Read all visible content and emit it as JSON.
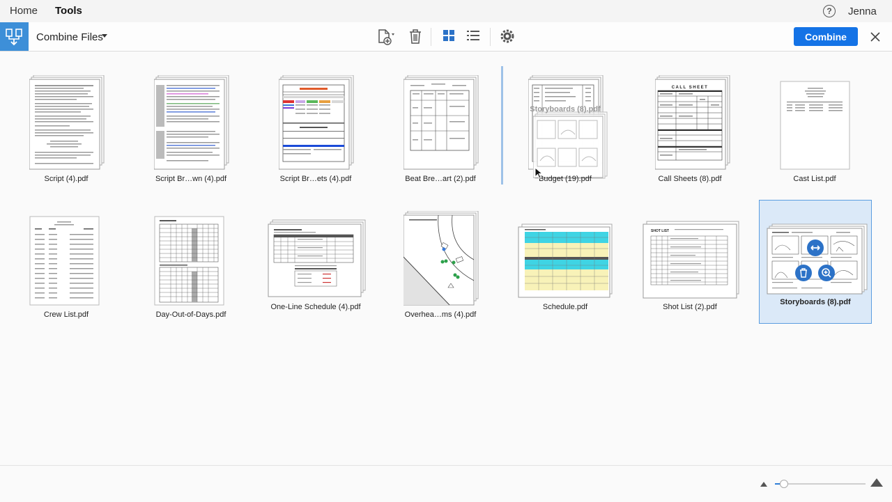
{
  "nav": {
    "tabs": [
      {
        "label": "Home"
      },
      {
        "label": "Tools"
      }
    ],
    "help_glyph": "?",
    "user": "Jenna"
  },
  "toolbar": {
    "title": "Combine Files",
    "combine_label": "Combine"
  },
  "files": [
    {
      "name": "Script (4).pdf"
    },
    {
      "name": "Script Br…wn (4).pdf"
    },
    {
      "name": "Script Br…ets (4).pdf"
    },
    {
      "name": "Beat Bre…art (2).pdf"
    },
    {
      "name": "Budget (19).pdf"
    },
    {
      "name": "Call Sheets (8).pdf"
    },
    {
      "name": "Cast List.pdf"
    },
    {
      "name": "Crew List.pdf"
    },
    {
      "name": "Day-Out-of-Days.pdf"
    },
    {
      "name": "One-Line Schedule (4).pdf"
    },
    {
      "name": "Overhea…ms (4).pdf"
    },
    {
      "name": "Schedule.pdf"
    },
    {
      "name": "Shot List (2).pdf"
    },
    {
      "name": "Storyboards (8).pdf"
    }
  ],
  "drag": {
    "ghost_label": "Storyboards (8).pdf"
  },
  "page_headings": {
    "call_sheet": "CALL SHEET",
    "shot_list": "SHOT LIST"
  },
  "zoom": {
    "level": 0.1
  },
  "colors": {
    "accent": "#1473e6",
    "selection": "#dbe9f8",
    "app_icon": "#3d8fd8"
  }
}
